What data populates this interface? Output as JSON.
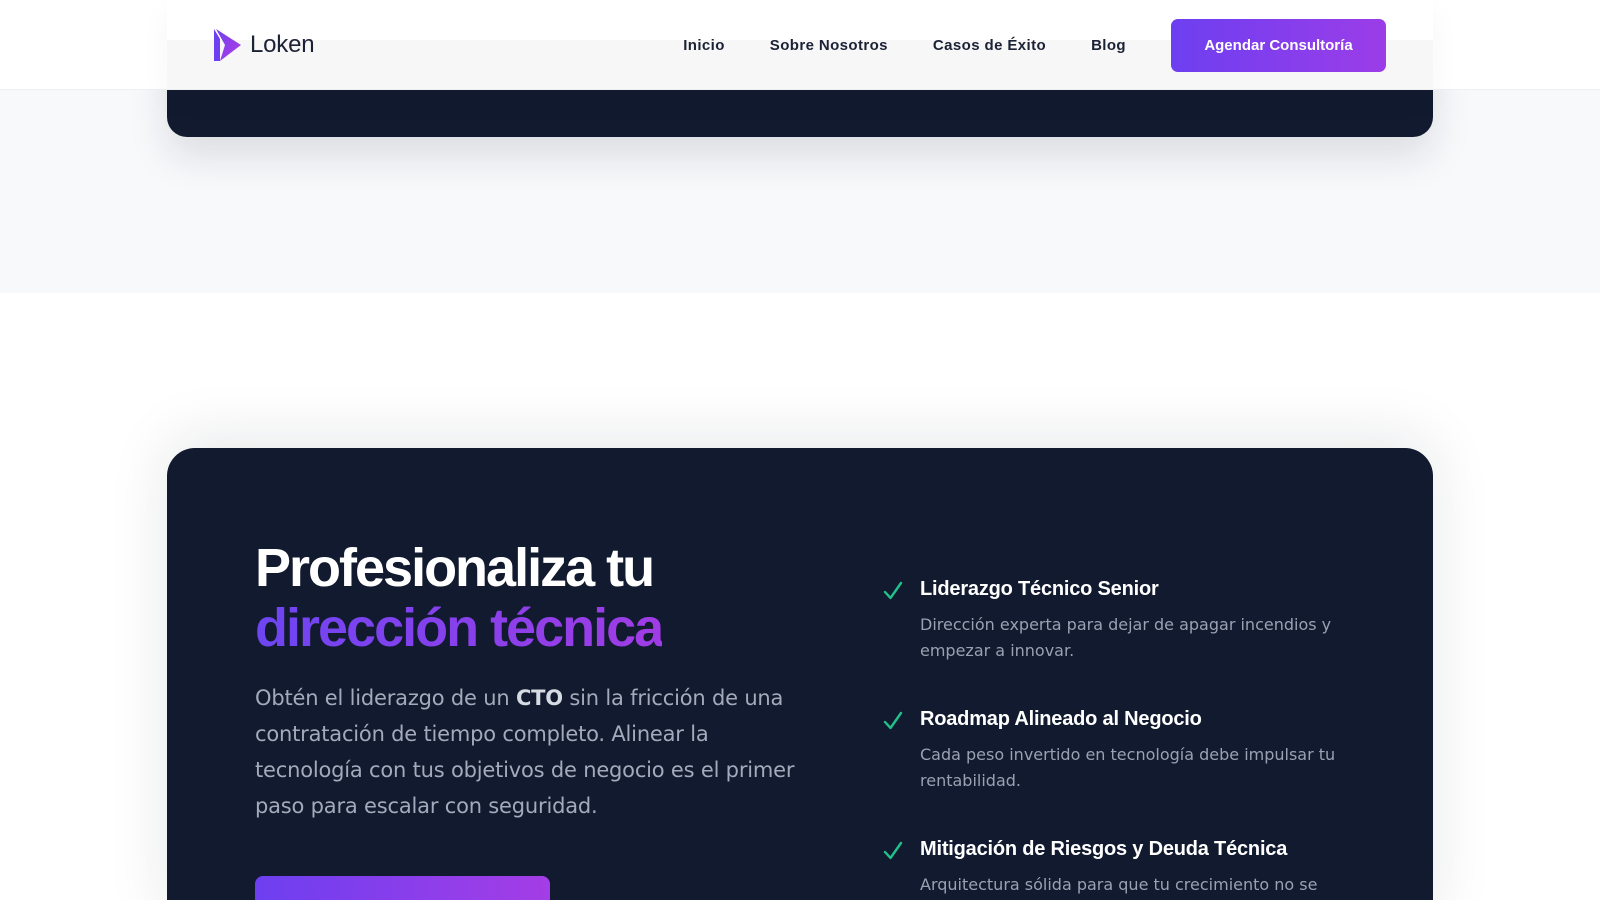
{
  "navbar": {
    "brand": "Loken",
    "links": [
      "Inicio",
      "Sobre Nosotros",
      "Casos de Éxito",
      "Blog"
    ],
    "cta_label": "Agendar Consultoría"
  },
  "hero": {
    "headline_line1": "Profesionaliza tu",
    "headline_line2": "dirección técnica",
    "lead_before": "Obtén el liderazgo de un ",
    "lead_bold": "CTO",
    "lead_after": " sin la fricción de una contratación de tiempo completo. Alinear la tecnología con tus objetivos de negocio es el primer paso para escalar con seguridad."
  },
  "features": [
    {
      "title": "Liderazgo Técnico Senior",
      "description": "Dirección experta para dejar de apagar incendios y empezar a innovar."
    },
    {
      "title": "Roadmap Alineado al Negocio",
      "description": "Cada peso invertido en tecnología debe impulsar tu rentabilidad."
    },
    {
      "title": "Mitigación de Riesgos y Deuda Técnica",
      "description": "Arquitectura sólida para que tu crecimiento no se"
    }
  ],
  "colors": {
    "accent_start": "#6d3ff0",
    "accent_end": "#a43de6",
    "dark_card": "#111a2e",
    "check_green": "#22c08a"
  }
}
